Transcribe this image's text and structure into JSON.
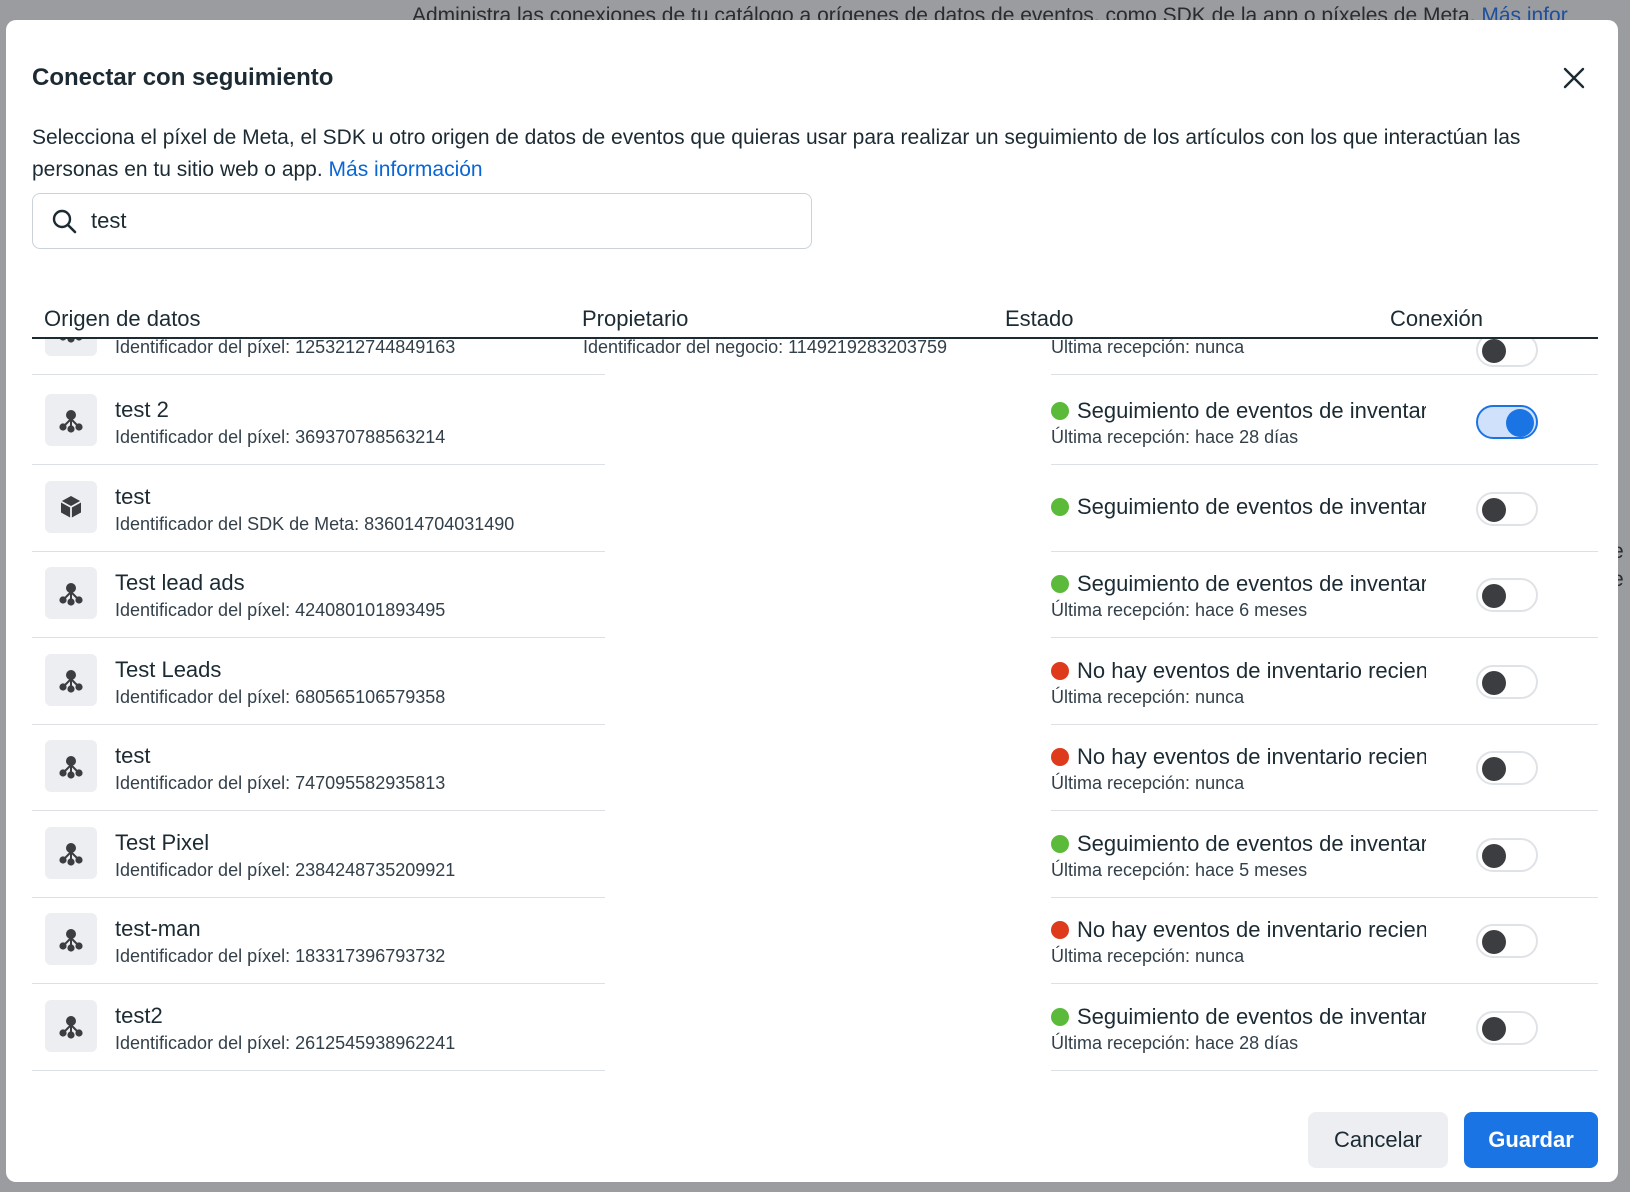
{
  "background": {
    "top_text": "Administra las conexiones de tu catálogo a orígenes de datos de eventos, como SDK de la app o píxeles de Meta.",
    "top_link": "Más infor",
    "side_chars": [
      "e",
      "e"
    ]
  },
  "dialog": {
    "title": "Conectar con seguimiento",
    "description": "Selecciona el píxel de Meta, el SDK u otro origen de datos de eventos que quieras usar para realizar un seguimiento de los artículos con los que interactúan las personas en tu sitio web o app.",
    "learn_more": "Más información"
  },
  "search": {
    "value": "test",
    "placeholder": ""
  },
  "columns": {
    "source": "Origen de datos",
    "owner": "Propietario",
    "status": "Estado",
    "connection": "Conexión"
  },
  "partial_row": {
    "ident": "Identificador del píxel: 1253212744849163",
    "owner": "Identificador del negocio: 1149219283203759",
    "last": "Última recepción: nunca"
  },
  "rows": [
    {
      "name": "test 2",
      "icon": "pixel-icon",
      "ident": "Identificador del píxel: 369370788563214",
      "status_color": "green",
      "status": "Seguimiento de eventos de inventario",
      "last": "Última recepción: hace 28 días",
      "connected": true
    },
    {
      "name": "test",
      "icon": "sdk-icon",
      "ident": "Identificador del SDK de Meta: 836014704031490",
      "status_color": "green",
      "status": "Seguimiento de eventos de inventario",
      "last": "",
      "connected": false
    },
    {
      "name": "Test lead ads",
      "icon": "pixel-icon",
      "ident": "Identificador del píxel: 424080101893495",
      "status_color": "green",
      "status": "Seguimiento de eventos de inventario",
      "last": "Última recepción: hace 6 meses",
      "connected": false
    },
    {
      "name": "Test Leads",
      "icon": "pixel-icon",
      "ident": "Identificador del píxel: 680565106579358",
      "status_color": "red",
      "status": "No hay eventos de inventario recientes",
      "last": "Última recepción: nunca",
      "connected": false
    },
    {
      "name": "test",
      "icon": "pixel-icon",
      "ident": "Identificador del píxel: 747095582935813",
      "status_color": "red",
      "status": "No hay eventos de inventario recientes",
      "last": "Última recepción: nunca",
      "connected": false
    },
    {
      "name": "Test Pixel",
      "icon": "pixel-icon",
      "ident": "Identificador del píxel: 2384248735209921",
      "status_color": "green",
      "status": "Seguimiento de eventos de inventario",
      "last": "Última recepción: hace 5 meses",
      "connected": false
    },
    {
      "name": "test-man",
      "icon": "pixel-icon",
      "ident": "Identificador del píxel: 183317396793732",
      "status_color": "red",
      "status": "No hay eventos de inventario recientes",
      "last": "Última recepción: nunca",
      "connected": false
    },
    {
      "name": "test2",
      "icon": "pixel-icon",
      "ident": "Identificador del píxel: 2612545938962241",
      "status_color": "green",
      "status": "Seguimiento de eventos de inventario",
      "last": "Última recepción: hace 28 días",
      "connected": false
    }
  ],
  "footer": {
    "cancel": "Cancelar",
    "save": "Guardar"
  },
  "colors": {
    "primary": "#1b74e4",
    "link": "#0a66d6",
    "status_ok": "#5cba3b",
    "status_error": "#dd3b1c"
  }
}
